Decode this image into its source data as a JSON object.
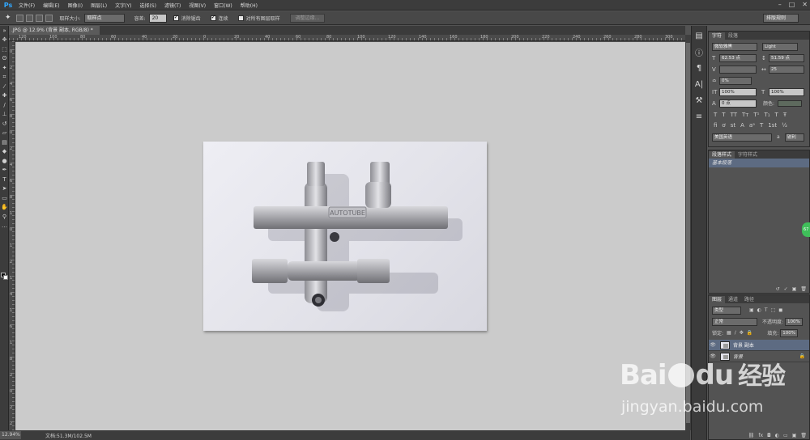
{
  "app": {
    "logo": "Ps",
    "menus": [
      "文件(F)",
      "编辑(E)",
      "图像(I)",
      "图层(L)",
      "文字(Y)",
      "选择(S)",
      "滤镜(T)",
      "视图(V)",
      "窗口(W)",
      "帮助(H)"
    ]
  },
  "options": {
    "sample_size_label": "取样大小:",
    "sample_size_value": "取样点",
    "tolerance_label": "容差:",
    "tolerance_value": "20",
    "antialias_label": "消除锯齿",
    "contiguous_label": "连续",
    "all_layers_label": "对所有图层取样",
    "refine_edge_label": "调整边缘...",
    "workspace_value": "排版规则"
  },
  "document": {
    "tab_title": ".JPG @ 12.9% (背景 副本, RGB/8) *"
  },
  "rulers": {
    "h_labels": [
      "120",
      "100",
      "80",
      "60",
      "40",
      "20",
      "0",
      "20",
      "40",
      "60",
      "80",
      "100",
      "120",
      "140",
      "160",
      "180",
      "200",
      "220",
      "240",
      "260",
      "280",
      "300"
    ],
    "v_labels": [
      "0",
      "2",
      "4",
      "6",
      "8",
      "0",
      "2",
      "4",
      "6",
      "8",
      "1",
      "0",
      "1",
      "2",
      "1",
      "4",
      "1",
      "6",
      "1",
      "8",
      "2",
      "0",
      "2",
      "2"
    ]
  },
  "status": {
    "zoom": "12.94%",
    "doc_info": "文档:51.3M/102.5M"
  },
  "character_panel": {
    "tabs": [
      "字符",
      "段落"
    ],
    "font_family": "微软雅黑",
    "font_style": "Light",
    "font_size": "62.53 点",
    "leading": "51.59 点",
    "kerning": "",
    "tracking": "25",
    "tsume": "0%",
    "vscale": "100%",
    "hscale": "100%",
    "baseline": "0 点",
    "color_label": "颜色:",
    "language": "美国英语",
    "aa_label": "a",
    "aa_value": "锐利"
  },
  "paragraph_styles": {
    "tabs": [
      "段落样式",
      "字符样式"
    ],
    "item": "基本段落"
  },
  "layers_panel": {
    "tabs": [
      "图层",
      "通道",
      "路径"
    ],
    "filter_kind": "类型",
    "blend_mode": "正常",
    "opacity_label": "不透明度:",
    "opacity_value": "100%",
    "lock_label": "锁定:",
    "fill_label": "填充:",
    "fill_value": "100%",
    "layers": [
      {
        "name": "背景 副本",
        "selected": true
      },
      {
        "name": "背景",
        "selected": false
      }
    ]
  },
  "watermark": {
    "brand": "Bai",
    "brand2": "du",
    "cn": "经验",
    "url": "jingyan.baidu.com"
  },
  "badge": "67"
}
